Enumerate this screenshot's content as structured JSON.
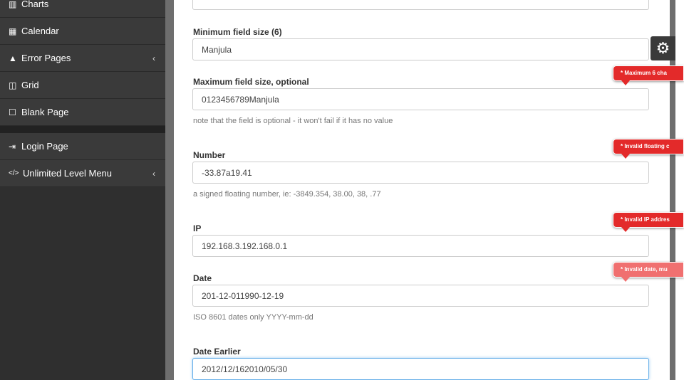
{
  "sidebar": {
    "items": [
      {
        "icon": "bar-chart-icon",
        "glyph": "▥",
        "label": "Charts"
      },
      {
        "icon": "calendar-icon",
        "glyph": "▦",
        "label": "Calendar"
      },
      {
        "icon": "warning-icon",
        "glyph": "▲",
        "label": "Error Pages",
        "chevron": "‹"
      },
      {
        "icon": "columns-icon",
        "glyph": "◫",
        "label": "Grid"
      },
      {
        "icon": "square-icon",
        "glyph": "☐",
        "label": "Blank Page"
      },
      {
        "icon": "sign-in-icon",
        "glyph": "⇥",
        "label": "Login Page"
      },
      {
        "icon": "code-icon",
        "glyph": "</>",
        "label": "Unlimited Level Menu",
        "chevron": "‹"
      }
    ]
  },
  "form": {
    "top_field_value": "",
    "min_size": {
      "label": "Minimum field size (6)",
      "value": "Manjula"
    },
    "max_size": {
      "label": "Maximum field size, optional",
      "value": "0123456789Manjula",
      "help": "note that the field is optional - it won't fail if it has no value",
      "error": "* Maximum 6 cha"
    },
    "number": {
      "label": "Number",
      "value": "-33.87a19.41",
      "help": "a signed floating number, ie: -3849.354, 38.00, 38, .77",
      "error": "* Invalid floating c"
    },
    "ip": {
      "label": "IP",
      "value": "192.168.3.192.168.0.1",
      "error": "* Invalid IP addres"
    },
    "date": {
      "label": "Date",
      "value": "201-12-011990-12-19",
      "help": "ISO 8601 dates only YYYY-mm-dd",
      "error": "* Invalid date, mu"
    },
    "date_earlier": {
      "label": "Date Earlier",
      "value": "2012/12/162010/05/30"
    }
  },
  "settings": {
    "icon": "gears-icon",
    "glyph": "⚙"
  },
  "colors": {
    "error": "#e32a2a",
    "sidebar": "#3a3a3a",
    "focus": "#66afe9"
  }
}
